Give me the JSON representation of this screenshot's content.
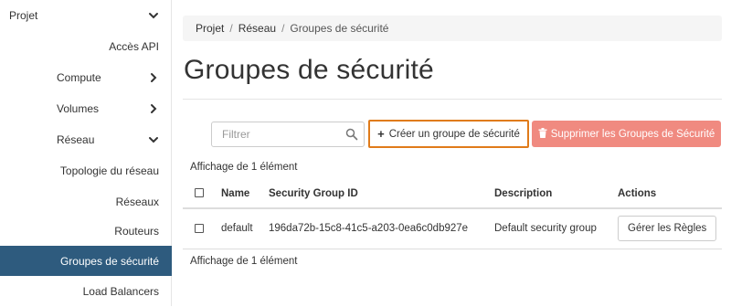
{
  "sidebar": {
    "items": [
      {
        "label": "Projet",
        "chevron": "down"
      },
      {
        "label": "Accès API"
      },
      {
        "label": "Compute",
        "chevron": "right"
      },
      {
        "label": "Volumes",
        "chevron": "right"
      },
      {
        "label": "Réseau",
        "chevron": "down"
      },
      {
        "label": "Topologie du réseau"
      },
      {
        "label": "Réseaux"
      },
      {
        "label": "Routeurs"
      },
      {
        "label": "Groupes de sécurité",
        "active": true
      },
      {
        "label": "Load Balancers"
      }
    ]
  },
  "breadcrumb": {
    "items": [
      "Projet",
      "Réseau"
    ],
    "current": "Groupes de sécurité",
    "separator": "/"
  },
  "page": {
    "title": "Groupes de sécurité"
  },
  "toolbar": {
    "search_placeholder": "Filtrer",
    "create_label": "Créer un groupe de sécurité",
    "delete_label": "Supprimer les Groupes de Sécurité"
  },
  "table": {
    "count_top": "Affichage de 1 élément",
    "count_bottom": "Affichage de 1 élément",
    "headers": {
      "name": "Name",
      "id": "Security Group ID",
      "description": "Description",
      "actions": "Actions"
    },
    "rows": [
      {
        "name": "default",
        "id": "196da72b-15c8-41c5-a203-0ea6c0db927e",
        "description": "Default security group",
        "action": "Gérer les Règles"
      }
    ]
  },
  "colors": {
    "sidebar_active": "#2e5b7e",
    "create_border": "#e07b1a",
    "delete_bg": "#f08a80"
  }
}
